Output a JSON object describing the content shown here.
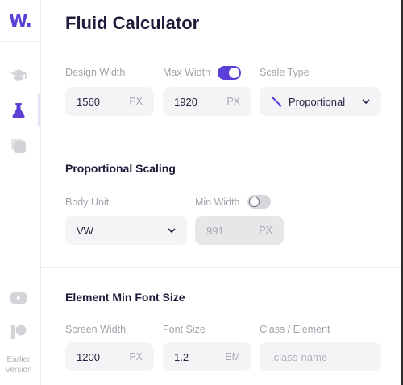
{
  "app": {
    "logo_text": "W.",
    "title": "Fluid Calculator"
  },
  "sidebar": {
    "items": [
      {
        "name": "course",
        "icon": "graduation-cap-icon"
      },
      {
        "name": "calculator",
        "icon": "flask-icon",
        "active": true
      },
      {
        "name": "library",
        "icon": "copy-stack-icon"
      },
      {
        "name": "youtube",
        "icon": "youtube-icon"
      },
      {
        "name": "patreon",
        "icon": "patreon-icon"
      }
    ],
    "earlier_version_label": "Earlier Version"
  },
  "design": {
    "design_width": {
      "label": "Design Width",
      "value": "1560",
      "unit": "PX"
    },
    "max_width": {
      "label": "Max Width",
      "value": "1920",
      "unit": "PX",
      "toggle_on": true
    },
    "scale_type": {
      "label": "Scale Type",
      "value": "Proportional",
      "icon": "diagonal-line-icon"
    }
  },
  "proportional": {
    "title": "Proportional Scaling",
    "body_unit": {
      "label": "Body Unit",
      "value": "VW"
    },
    "min_width": {
      "label": "Min Width",
      "value": "991",
      "unit": "PX",
      "toggle_on": false
    }
  },
  "min_font": {
    "title": "Element Min Font Size",
    "screen_width": {
      "label": "Screen Width",
      "value": "1200",
      "unit": "PX"
    },
    "font_size": {
      "label": "Font Size",
      "value": "1.2",
      "unit": "EM"
    },
    "class_element": {
      "label": "Class / Element",
      "placeholder": ".class-name"
    }
  },
  "colors": {
    "accent": "#5b3fd6",
    "text": "#1e1c3a",
    "muted": "#a3a2ad",
    "field_bg": "#f4f4f6"
  }
}
